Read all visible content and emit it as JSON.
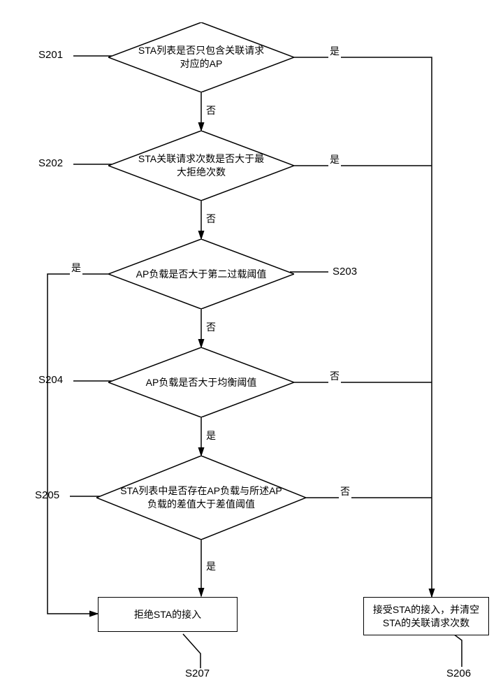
{
  "chart_data": {
    "type": "flowchart",
    "nodes": [
      {
        "id": "d1",
        "shape": "diamond",
        "label": "STA列表是否只包含关联请求对应的AP",
        "ref": "S201"
      },
      {
        "id": "d2",
        "shape": "diamond",
        "label": "STA关联请求次数是否大于最大拒绝次数",
        "ref": "S202"
      },
      {
        "id": "d3",
        "shape": "diamond",
        "label": "AP负载是否大于第二过载阈值",
        "ref": "S203"
      },
      {
        "id": "d4",
        "shape": "diamond",
        "label": "AP负载是否大于均衡阈值",
        "ref": "S204"
      },
      {
        "id": "d5",
        "shape": "diamond",
        "label": "STA列表中是否存在AP负载与所述AP负载的差值大于差值阈值",
        "ref": "S205"
      },
      {
        "id": "r_accept",
        "shape": "rect",
        "label": "接受STA的接入，并清空STA的关联请求次数",
        "ref": "S206"
      },
      {
        "id": "r_reject",
        "shape": "rect",
        "label": "拒绝STA的接入",
        "ref": "S207"
      }
    ],
    "edges": [
      {
        "from": "d1",
        "to": "r_accept",
        "label": "是"
      },
      {
        "from": "d1",
        "to": "d2",
        "label": "否"
      },
      {
        "from": "d2",
        "to": "r_accept",
        "label": "是"
      },
      {
        "from": "d2",
        "to": "d3",
        "label": "否"
      },
      {
        "from": "d3",
        "to": "r_reject",
        "label": "是"
      },
      {
        "from": "d3",
        "to": "d4",
        "label": "否"
      },
      {
        "from": "d4",
        "to": "r_accept",
        "label": "否"
      },
      {
        "from": "d4",
        "to": "d5",
        "label": "是"
      },
      {
        "from": "d5",
        "to": "r_accept",
        "label": "否"
      },
      {
        "from": "d5",
        "to": "r_reject",
        "label": "是"
      }
    ]
  },
  "labels": {
    "s201": "S201",
    "s202": "S202",
    "s203": "S203",
    "s204": "S204",
    "s205": "S205",
    "s206": "S206",
    "s207": "S207",
    "yes": "是",
    "no": "否"
  },
  "nodes": {
    "d1": "STA列表是否只包含关联请求对应的AP",
    "d2": "STA关联请求次数是否大于最大拒绝次数",
    "d3": "AP负载是否大于第二过载阈值",
    "d4": "AP负载是否大于均衡阈值",
    "d5": "STA列表中是否存在AP负载与所述AP负载的差值大于差值阈值",
    "accept": "接受STA的接入，并清空STA的关联请求次数",
    "reject": "拒绝STA的接入"
  }
}
